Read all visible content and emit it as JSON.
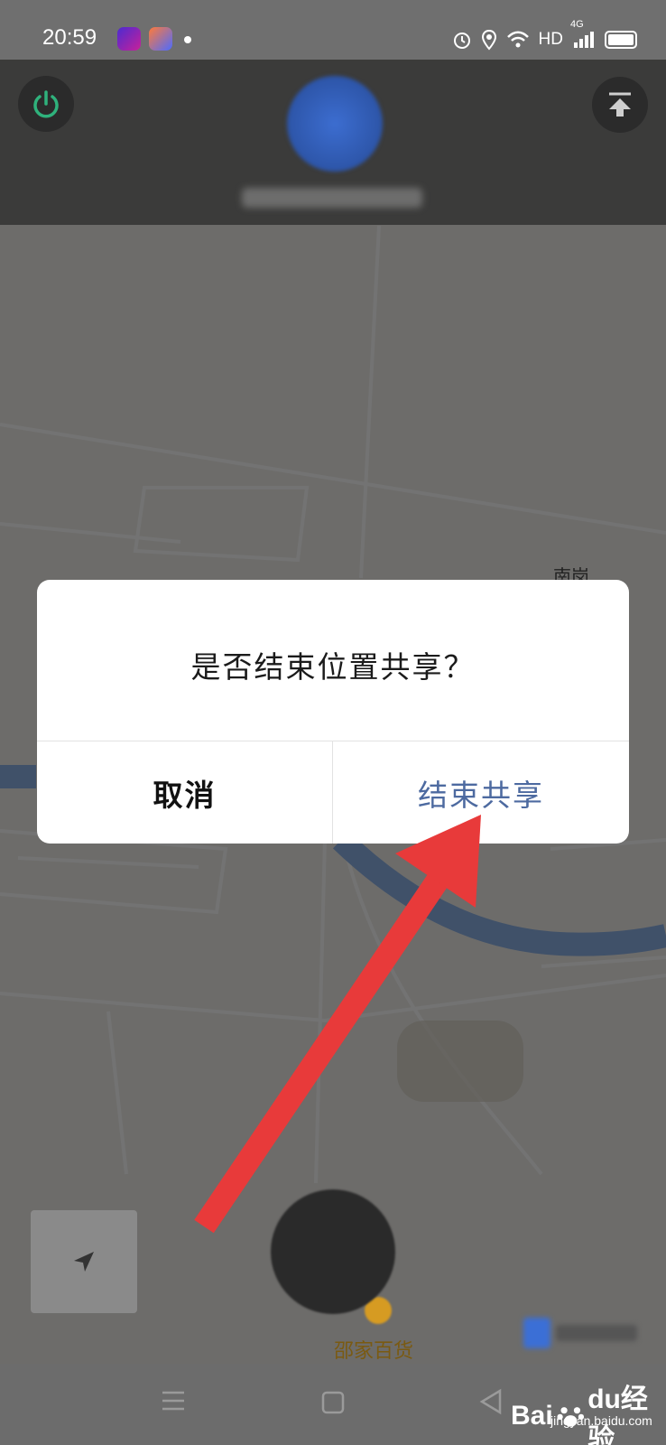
{
  "status_bar": {
    "time": "20:59",
    "network_label": "HD",
    "signal_label": "4G"
  },
  "map": {
    "place_label": "南岗",
    "shop_label": "邵家百货"
  },
  "dialog": {
    "title": "是否结束位置共享？",
    "cancel_label": "取消",
    "confirm_label": "结束共享"
  },
  "watermark": {
    "brand": "Bai",
    "brand_suffix": "du经验",
    "url": "jingyan.baidu.com"
  },
  "icons": {
    "power": "power-icon",
    "upload": "upload-top-icon",
    "locate": "navigation-arrow-icon",
    "alarm": "alarm-icon",
    "location": "location-pin-icon",
    "wifi": "wifi-icon",
    "battery": "battery-icon",
    "nav_menu": "menu-icon",
    "nav_home": "home-square-icon",
    "nav_back": "back-triangle-icon"
  },
  "colors": {
    "confirm_text": "#4d6aa0",
    "annotation_arrow": "#e83a3a",
    "power_icon": "#2fb27c"
  }
}
